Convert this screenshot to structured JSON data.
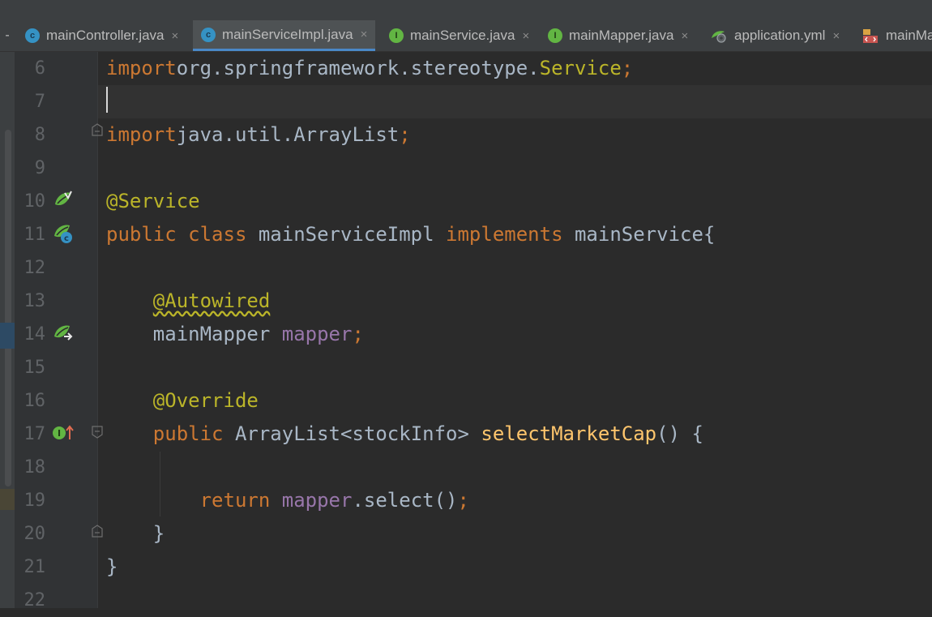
{
  "tabs": [
    {
      "label": "mainController.java",
      "icon": "class-icon",
      "active": false
    },
    {
      "label": "mainServiceImpl.java",
      "icon": "class-icon",
      "active": true
    },
    {
      "label": "mainService.java",
      "icon": "interface-icon",
      "active": false
    },
    {
      "label": "mainMapper.java",
      "icon": "interface-icon",
      "active": false
    },
    {
      "label": "application.yml",
      "icon": "yml-icon",
      "active": false
    },
    {
      "label": "mainMa",
      "icon": "xml-icon",
      "active": false
    }
  ],
  "tab_close_glyph": "×",
  "tab_lead_glyph": "-",
  "class_icon_letter": "c",
  "interface_icon_letter": "I",
  "lines": [
    {
      "num": "6",
      "tokens": [
        [
          "kw",
          "import"
        ],
        [
          "",
          "org.springframework.stereotype."
        ],
        [
          "ann",
          "Service"
        ],
        [
          "kw",
          ";"
        ]
      ]
    },
    {
      "num": "7",
      "tokens": []
    },
    {
      "num": "8",
      "tokens": [
        [
          "kw",
          "import"
        ],
        [
          "",
          "java.util.ArrayList"
        ],
        [
          "kw",
          ";"
        ]
      ]
    },
    {
      "num": "9",
      "tokens": []
    },
    {
      "num": "10",
      "tokens": [
        [
          "ann",
          "@Service"
        ]
      ]
    },
    {
      "num": "11",
      "tokens": [
        [
          "kw",
          "public class"
        ],
        [
          "",
          " mainServiceImpl "
        ],
        [
          "kw",
          "implements"
        ],
        [
          "",
          " mainService{"
        ]
      ]
    },
    {
      "num": "12",
      "tokens": []
    },
    {
      "num": "13",
      "tokens": [
        [
          "",
          "    "
        ],
        [
          "ann wavy",
          "@Autowired"
        ]
      ]
    },
    {
      "num": "14",
      "tokens": [
        [
          "",
          "    mainMapper "
        ],
        [
          "field",
          "mapper"
        ],
        [
          "kw",
          ";"
        ]
      ]
    },
    {
      "num": "15",
      "tokens": []
    },
    {
      "num": "16",
      "tokens": [
        [
          "",
          "    "
        ],
        [
          "ann",
          "@Override"
        ]
      ]
    },
    {
      "num": "17",
      "tokens": [
        [
          "",
          "    "
        ],
        [
          "kw",
          "public"
        ],
        [
          "",
          " ArrayList<stockInfo> "
        ],
        [
          "fn",
          "selectMarketCap"
        ],
        [
          "",
          "() {"
        ]
      ]
    },
    {
      "num": "18",
      "tokens": []
    },
    {
      "num": "19",
      "tokens": [
        [
          "",
          "        "
        ],
        [
          "kw",
          "return"
        ],
        [
          "",
          " "
        ],
        [
          "field",
          "mapper"
        ],
        [
          "",
          ".select()"
        ],
        [
          "kw",
          ";"
        ]
      ]
    },
    {
      "num": "20",
      "tokens": [
        [
          "",
          "    }"
        ]
      ]
    },
    {
      "num": "21",
      "tokens": [
        [
          "",
          "}"
        ]
      ]
    },
    {
      "num": "22",
      "tokens": []
    }
  ],
  "current_line": "7",
  "colors": {
    "keyword": "#cc7832",
    "annotation": "#bbb529",
    "field": "#9876aa",
    "method": "#ffc66d",
    "text": "#a9b7c6",
    "line_number": "#606366",
    "background": "#2b2b2b",
    "active_tab_underline": "#4a88c7"
  }
}
